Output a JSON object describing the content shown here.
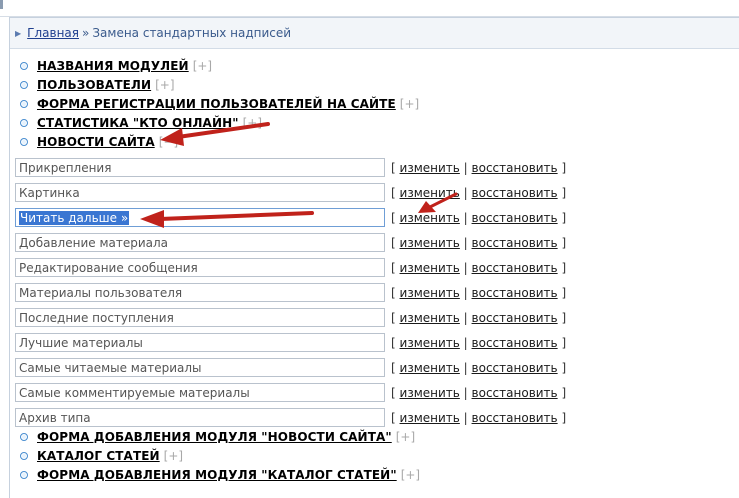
{
  "breadcrumb": {
    "home": "Главная",
    "separator": "»",
    "current": "Замена стандартных надписей"
  },
  "modules_top": [
    {
      "label": "НАЗВАНИЯ МОДУЛЕЙ",
      "toggle": "[+]"
    },
    {
      "label": "ПОЛЬЗОВАТЕЛИ",
      "toggle": "[+]"
    },
    {
      "label": "ФОРМА РЕГИСТРАЦИИ ПОЛЬЗОВАТЕЛЕЙ НА САЙТЕ",
      "toggle": "[+]"
    },
    {
      "label": "СТАТИСТИКА \"КТО ОНЛАЙН\"",
      "toggle": "[+]"
    },
    {
      "label": "НОВОСТИ САЙТА",
      "toggle": "[−]"
    }
  ],
  "actions": {
    "open": "[",
    "edit": "изменить",
    "divider": "|",
    "restore": "восстановить",
    "close": "]"
  },
  "fields": [
    {
      "value": "Прикрепления"
    },
    {
      "value": "Картинка"
    },
    {
      "value": "Читать дальше »",
      "selected": true
    },
    {
      "value": "Добавление материала"
    },
    {
      "value": "Редактирование сообщения"
    },
    {
      "value": "Материалы пользователя"
    },
    {
      "value": "Последние поступления"
    },
    {
      "value": "Лучшие материалы"
    },
    {
      "value": "Самые читаемые материалы"
    },
    {
      "value": "Самые комментируемые материалы"
    },
    {
      "value": "Архив типа"
    }
  ],
  "modules_bottom": [
    {
      "label": "ФОРМА ДОБАВЛЕНИЯ МОДУЛЯ \"НОВОСТИ САЙТА\"",
      "toggle": "[+]"
    },
    {
      "label": "КАТАЛОГ СТАТЕЙ",
      "toggle": "[+]"
    },
    {
      "label": "ФОРМА ДОБАВЛЕНИЯ МОДУЛЯ \"КАТАЛОГ СТАТЕЙ\"",
      "toggle": "[+]"
    }
  ],
  "colors": {
    "annotation_arrow": "#c0221b",
    "selection": "#3a76d2",
    "bullet": "#4a8ed0"
  }
}
